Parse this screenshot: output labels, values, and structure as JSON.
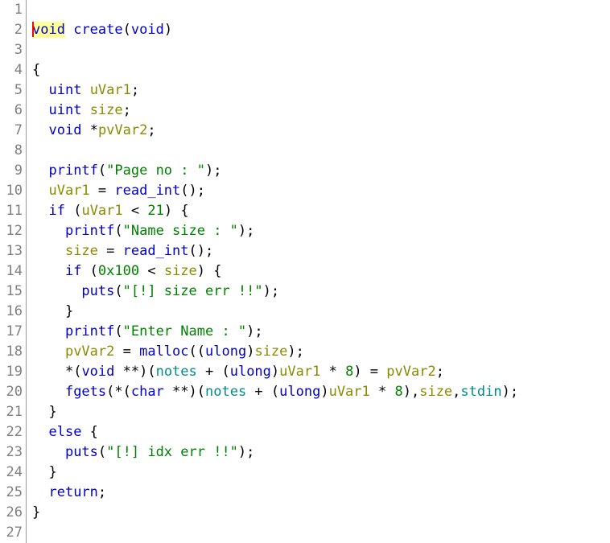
{
  "editor": {
    "kind": "decompiler-code-view",
    "language": "C",
    "function_name": "create",
    "total_lines": 27,
    "background_color": "#ffffff",
    "gutter_color": "#808080",
    "gutter_rule_color": "#9b9b9b",
    "caret_color": "#ff0000",
    "highlight_color": "#ffff99",
    "selected_token": "void",
    "cursor_line": 2,
    "cursor_column": 1
  },
  "palette": {
    "keyword": "#0000cc",
    "type": "#0000cc",
    "function": "#0000cc",
    "variable": "#8a8a00",
    "global": "#008b8b",
    "string": "#008000",
    "number": "#008000",
    "punctuation": "#000000"
  },
  "line_numbers": [
    "1",
    "2",
    "3",
    "4",
    "5",
    "6",
    "7",
    "8",
    "9",
    "10",
    "11",
    "12",
    "13",
    "14",
    "15",
    "16",
    "17",
    "18",
    "19",
    "20",
    "21",
    "22",
    "23",
    "24",
    "25",
    "26",
    "27"
  ],
  "code_lines": [
    {
      "n": 1,
      "text": ""
    },
    {
      "n": 2,
      "text": "void create(void)"
    },
    {
      "n": 3,
      "text": ""
    },
    {
      "n": 4,
      "text": "{"
    },
    {
      "n": 5,
      "text": "  uint uVar1;"
    },
    {
      "n": 6,
      "text": "  uint size;"
    },
    {
      "n": 7,
      "text": "  void *pvVar2;"
    },
    {
      "n": 8,
      "text": ""
    },
    {
      "n": 9,
      "text": "  printf(\"Page no : \");"
    },
    {
      "n": 10,
      "text": "  uVar1 = read_int();"
    },
    {
      "n": 11,
      "text": "  if (uVar1 < 21) {"
    },
    {
      "n": 12,
      "text": "    printf(\"Name size : \");"
    },
    {
      "n": 13,
      "text": "    size = read_int();"
    },
    {
      "n": 14,
      "text": "    if (0x100 < size) {"
    },
    {
      "n": 15,
      "text": "      puts(\"[!] size err !!\");"
    },
    {
      "n": 16,
      "text": "    }"
    },
    {
      "n": 17,
      "text": "    printf(\"Enter Name : \");"
    },
    {
      "n": 18,
      "text": "    pvVar2 = malloc((ulong)size);"
    },
    {
      "n": 19,
      "text": "    *(void **)(notes + (ulong)uVar1 * 8) = pvVar2;"
    },
    {
      "n": 20,
      "text": "    fgets(*(char **)(notes + (ulong)uVar1 * 8),size,stdin);"
    },
    {
      "n": 21,
      "text": "  }"
    },
    {
      "n": 22,
      "text": "  else {"
    },
    {
      "n": 23,
      "text": "    puts(\"[!] idx err !!\");"
    },
    {
      "n": 24,
      "text": "  }"
    },
    {
      "n": 25,
      "text": "  return;"
    },
    {
      "n": 26,
      "text": "}"
    },
    {
      "n": 27,
      "text": ""
    }
  ],
  "tokens": {
    "l2": {
      "void1": "void",
      "sp1": " ",
      "create": "create",
      "lp": "(",
      "void2": "void",
      "rp": ")"
    },
    "l4": {
      "brace": "{"
    },
    "l5": {
      "indent": "  ",
      "type": "uint",
      "sp": " ",
      "var": "uVar1",
      "semi": ";"
    },
    "l6": {
      "indent": "  ",
      "type": "uint",
      "sp": " ",
      "var": "size",
      "semi": ";"
    },
    "l7": {
      "indent": "  ",
      "type": "void",
      "sp": " ",
      "star": "*",
      "var": "pvVar2",
      "semi": ";"
    },
    "l9": {
      "indent": "  ",
      "fn": "printf",
      "lp": "(",
      "str": "\"Page no : \"",
      "rp": ");"
    },
    "l10": {
      "indent": "  ",
      "var": "uVar1",
      "eq": " = ",
      "fn": "read_int",
      "rp": "();"
    },
    "l11": {
      "indent": "  ",
      "kw": "if",
      "lp": " (",
      "var": "uVar1",
      "op": " < ",
      "num": "21",
      "rp": ") {"
    },
    "l12": {
      "indent": "    ",
      "fn": "printf",
      "lp": "(",
      "str": "\"Name size : \"",
      "rp": ");"
    },
    "l13": {
      "indent": "    ",
      "var": "size",
      "eq": " = ",
      "fn": "read_int",
      "rp": "();"
    },
    "l14": {
      "indent": "    ",
      "kw": "if",
      "lp": " (",
      "num": "0x100",
      "op": " < ",
      "var": "size",
      "rp": ") {"
    },
    "l15": {
      "indent": "      ",
      "fn": "puts",
      "lp": "(",
      "str": "\"[!] size err !!\"",
      "rp": ");"
    },
    "l16": {
      "indent": "    ",
      "brace": "}"
    },
    "l17": {
      "indent": "    ",
      "fn": "printf",
      "lp": "(",
      "str": "\"Enter Name : \"",
      "rp": ");"
    },
    "l18": {
      "indent": "    ",
      "var": "pvVar2",
      "eq": " = ",
      "fn": "malloc",
      "lp": "((",
      "type": "ulong",
      "rp1": ")",
      "var2": "size",
      "rp2": ");"
    },
    "l19": {
      "indent": "    ",
      "p1": "*(",
      "type": "void",
      "p2": " **)(",
      "glob": "notes",
      "p3": " + (",
      "type2": "ulong",
      "p4": ")",
      "var": "uVar1",
      "p5": " * ",
      "num": "8",
      "p6": ") = ",
      "var2": "pvVar2",
      "p7": ";"
    },
    "l20": {
      "indent": "    ",
      "fn": "fgets",
      "p1": "(*(",
      "type": "char",
      "p2": " **)(",
      "glob": "notes",
      "p3": " + (",
      "type2": "ulong",
      "p4": ")",
      "var": "uVar1",
      "p5": " * ",
      "num": "8",
      "p6": "),",
      "var2": "size",
      "p7": ",",
      "glob2": "stdin",
      "p8": ");"
    },
    "l21": {
      "indent": "  ",
      "brace": "}"
    },
    "l22": {
      "indent": "  ",
      "kw": "else",
      "brace": " {"
    },
    "l23": {
      "indent": "    ",
      "fn": "puts",
      "lp": "(",
      "str": "\"[!] idx err !!\"",
      "rp": ");"
    },
    "l24": {
      "indent": "  ",
      "brace": "}"
    },
    "l25": {
      "indent": "  ",
      "kw": "return",
      "semi": ";"
    },
    "l26": {
      "brace": "}"
    }
  }
}
